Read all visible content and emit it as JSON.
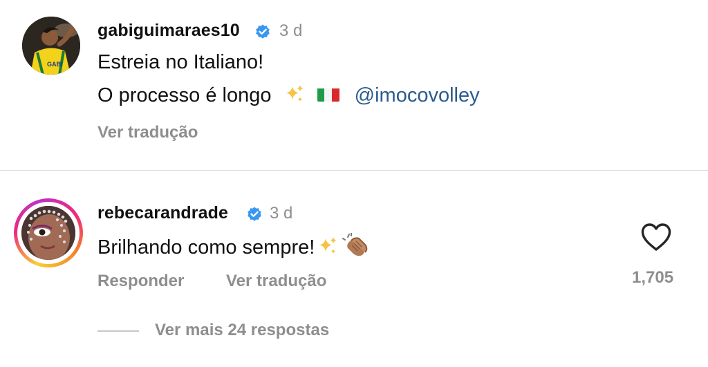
{
  "post": {
    "username": "gabiguimaraes10",
    "time": "3 d",
    "line1": "Estreia no Italiano!",
    "line2_text": "O processo é longo",
    "line2_mention": "@imocovolley",
    "translate_label": "Ver tradução",
    "avatar_jersey_text": "GABI"
  },
  "comment": {
    "username": "rebecarandrade",
    "time": "3 d",
    "text": "Brilhando como sempre!",
    "reply_label": "Responder",
    "translate_label": "Ver tradução",
    "likes": "1,705",
    "view_replies_label": "Ver mais 24 respostas"
  },
  "colors": {
    "verified_badge": "#3897f0",
    "mention": "#2a5b8f",
    "muted_text": "#8e8e8e"
  },
  "icons": [
    "verified-badge-icon",
    "sparkles-emoji-icon",
    "italy-flag-icon",
    "clapping-hands-emoji-icon",
    "heart-icon"
  ]
}
